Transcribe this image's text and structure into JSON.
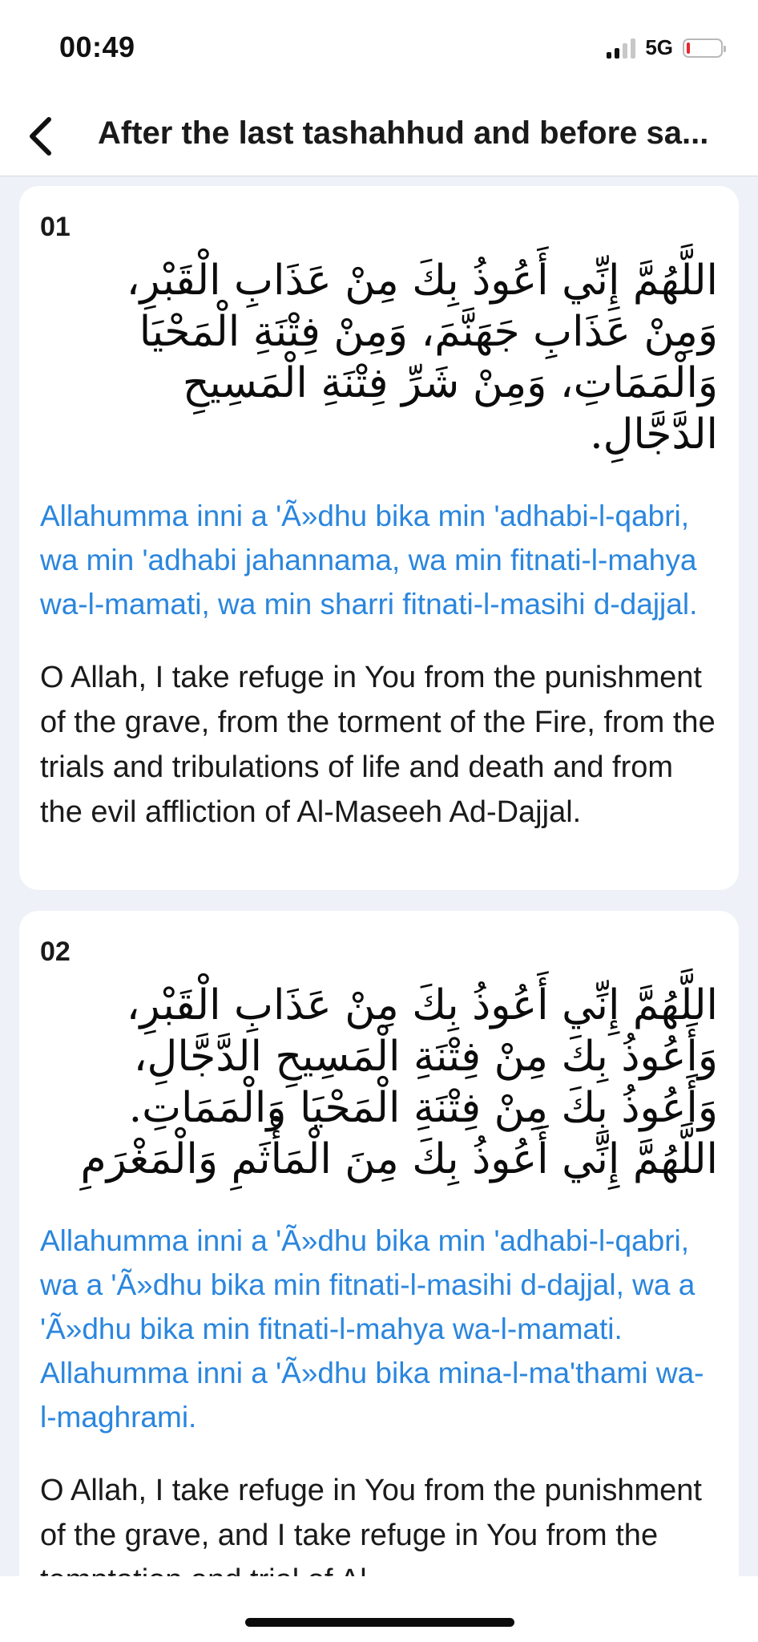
{
  "status_bar": {
    "time": "00:49",
    "network": "5G",
    "battery_color": "#e8262b"
  },
  "header": {
    "back_icon": "chevron-left-icon",
    "title": "After the last tashahhud and before sa..."
  },
  "duas": [
    {
      "number": "01",
      "arabic": "اللَّهُمَّ إِنِّي أَعُوذُ بِكَ مِنْ عَذَابِ الْقَبْرِ، وَمِنْ عَذَابِ جَهَنَّمَ، وَمِنْ فِتْنَةِ الْمَحْيَا وَالْمَمَاتِ، وَمِنْ شَرِّ فِتْنَةِ الْمَسِيحِ الدَّجَّالِ.",
      "transliteration": "Allahumma inni a 'Ã»dhu bika min 'adhabi-l-qabri, wa min 'adhabi jahannama, wa min fitnati-l-mahya wa-l-mamati, wa min sharri fitnati-l-masihi d-dajjal.",
      "translation": "O Allah, I take refuge in You from the punishment of the grave, from the torment of the Fire, from the trials and tribulations of life and death and from the evil affliction of Al-Maseeh Ad-Dajjal."
    },
    {
      "number": "02",
      "arabic": "اللَّهُمَّ إِنِّي أَعُوذُ بِكَ مِنْ عَذَابِ الْقَبْرِ، وَأَعُوذُ بِكَ مِنْ فِتْنَةِ الْمَسِيحِ الدَّجَّالِ، وَأَعُوذُ بِكَ مِنْ فِتْنَةِ الْمَحْيَا وَالْمَمَاتِ. اللَّهُمَّ إِنِّي أَعُوذُ بِكَ مِنَ الْمَأْثَمِ وَالْمَغْرَمِ",
      "transliteration": "Allahumma inni a 'Ã»dhu bika min 'adhabi-l-qabri, wa a 'Ã»dhu bika min fitnati-l-masihi d-dajjal, wa a 'Ã»dhu bika min fitnati-l-mahya wa-l-mamati. Allahumma inni a 'Ã»dhu bika mina-l-ma'thami wa-l-maghrami.",
      "translation": "O Allah, I take refuge in You from the punishment of the grave, and I take refuge in You from the temptation and trial of Al-"
    }
  ],
  "colors": {
    "transliteration": "#2a86de",
    "background": "#eef1f7",
    "card": "#ffffff"
  }
}
